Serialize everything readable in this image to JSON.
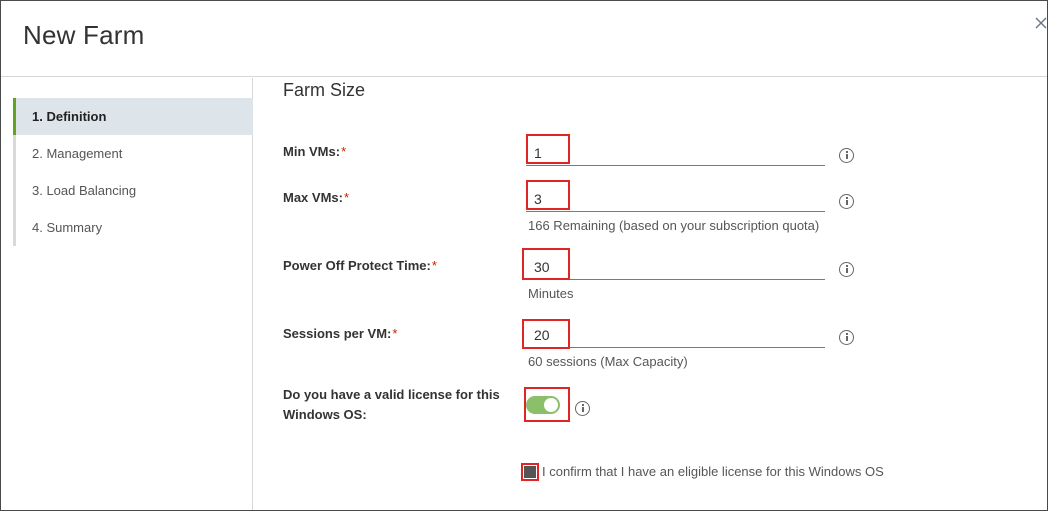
{
  "dialog": {
    "title": "New Farm",
    "close_icon": "close-icon"
  },
  "wizard": {
    "steps": [
      {
        "label": "1. Definition",
        "active": true
      },
      {
        "label": "2. Management",
        "active": false
      },
      {
        "label": "3. Load Balancing",
        "active": false
      },
      {
        "label": "4. Summary",
        "active": false
      }
    ]
  },
  "form": {
    "section_title": "Farm Size",
    "required_marker": "*",
    "min_vms": {
      "label": "Min VMs:",
      "value": "1"
    },
    "max_vms": {
      "label": "Max VMs:",
      "value": "3",
      "helper": "166 Remaining (based on your subscription quota)"
    },
    "power_off": {
      "label": "Power Off Protect Time:",
      "value": "30",
      "helper": "Minutes"
    },
    "sessions": {
      "label": "Sessions per VM:",
      "value": "20",
      "helper": "60 sessions (Max Capacity)"
    },
    "license": {
      "label_line1": "Do you have a valid license for this",
      "label_line2": "Windows OS:",
      "toggle_on": true
    },
    "confirm": {
      "text": "I confirm that I have an eligible license for this Windows OS",
      "checked": true
    }
  },
  "colors": {
    "active_step_accent": "#62a420",
    "active_step_bg": "#dde4ea",
    "highlight_box": "#e02525",
    "required": "#c92100",
    "toggle_on": "#8cbf6a"
  }
}
